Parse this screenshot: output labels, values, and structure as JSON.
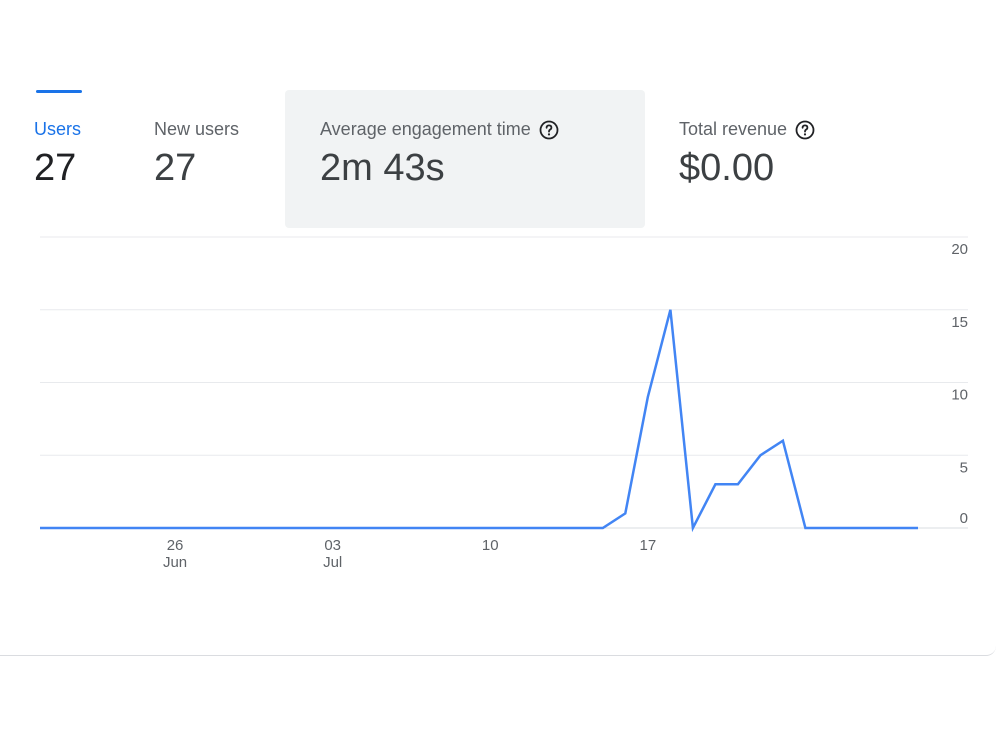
{
  "metrics": [
    {
      "label": "Users",
      "value": "27",
      "active": true
    },
    {
      "label": "New users",
      "value": "27"
    },
    {
      "label": "Average engagement time",
      "value": "2m 43s",
      "help_icon": "help-circle-icon",
      "hovered": true
    },
    {
      "label": "Total revenue",
      "value": "$0.00",
      "help_icon": "help-circle-icon"
    }
  ],
  "colors": {
    "accent": "#1a73e8",
    "line": "#4285f4",
    "grid": "#e8eaed",
    "text": "#5f6368"
  },
  "chart_data": {
    "type": "line",
    "series": [
      {
        "values": [
          0,
          0,
          0,
          0,
          0,
          0,
          0,
          0,
          0,
          0,
          0,
          0,
          0,
          0,
          0,
          0,
          0,
          0,
          0,
          0,
          0,
          0,
          0,
          0,
          0,
          0,
          1,
          9,
          15,
          0,
          3,
          3,
          5,
          6,
          0,
          0,
          0,
          0,
          0,
          0
        ]
      }
    ],
    "x_start_day": "2023-06-20",
    "x_ticks": [
      {
        "index": 6,
        "label": "26",
        "sub": "Jun"
      },
      {
        "index": 13,
        "label": "03",
        "sub": "Jul"
      },
      {
        "index": 20,
        "label": "10",
        "sub": ""
      },
      {
        "index": 27,
        "label": "17",
        "sub": ""
      }
    ],
    "y_ticks": [
      0,
      5,
      10,
      15,
      20
    ],
    "ylim": [
      0,
      20
    ],
    "grid": true
  }
}
